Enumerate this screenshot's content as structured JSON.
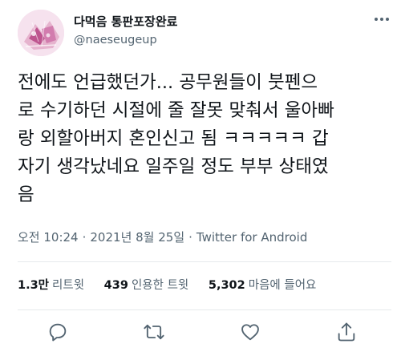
{
  "tweet": {
    "display_name": "다먹음 통판포장완료",
    "handle": "@naeseugeup",
    "text_lines": [
      "전에도 언급했던가... 공무원들이 붓펜으",
      "로 수기하던 시절에 줄 잘못 맞춰서 울아빠",
      "랑 외할아버지 혼인신고 됨 ㅋㅋㅋㅋㅋ 갑",
      "자기 생각났네요 일주일 정도 부부 상태였",
      "음"
    ],
    "time": "오전 10:24",
    "date": "2021년 8월 25일",
    "source": "Twitter for Android",
    "separator": "·"
  },
  "stats": {
    "retweets_count": "1.3만",
    "retweets_label": "리트윗",
    "quotes_count": "439",
    "quotes_label": "인용한 트윗",
    "likes_count": "5,302",
    "likes_label": "마음에 들어요"
  },
  "icons": {
    "more": "more-horizontal-icon",
    "reply": "reply-icon",
    "retweet": "retweet-icon",
    "like": "heart-icon",
    "share": "share-icon"
  },
  "colors": {
    "text": "#0f1419",
    "secondary": "#536471",
    "divider": "#e6e9ec",
    "avatar_bg": "#f3dbe8",
    "avatar_accent": "#b0357a"
  }
}
